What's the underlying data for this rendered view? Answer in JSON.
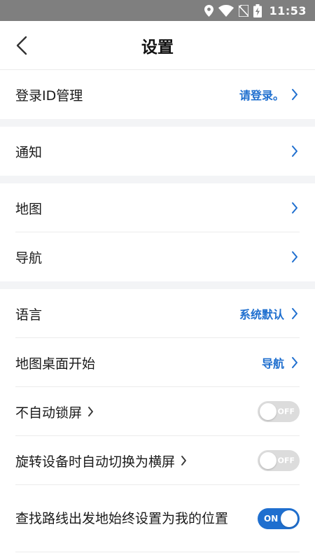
{
  "status_bar": {
    "time": "11:53",
    "icons": [
      "location-icon",
      "wifi-icon",
      "no-sim-icon",
      "battery-charging-icon"
    ]
  },
  "header": {
    "title": "设置",
    "back_icon": "chevron-left-icon"
  },
  "colors": {
    "accent": "#1f6fcf",
    "status_bar_bg": "#7f7f7f",
    "toggle_off": "#dcdcdc",
    "section_gap": "#f3f4f6"
  },
  "settings": {
    "login": {
      "label": "登录ID管理",
      "value": "请登录。"
    },
    "notifications": {
      "label": "通知"
    },
    "map": {
      "label": "地图"
    },
    "navigation": {
      "label": "导航"
    },
    "language": {
      "label": "语言",
      "value": "系统默认"
    },
    "map_desktop_start": {
      "label": "地图桌面开始",
      "value": "导航"
    },
    "no_auto_lock": {
      "label": "不自动锁屏",
      "toggle": "OFF"
    },
    "auto_landscape": {
      "label": "旋转设备时自动切换为横屏",
      "toggle": "OFF"
    },
    "route_start_my_location": {
      "label": "查找路线出发地始终设置为我的位置",
      "toggle": "ON"
    }
  }
}
